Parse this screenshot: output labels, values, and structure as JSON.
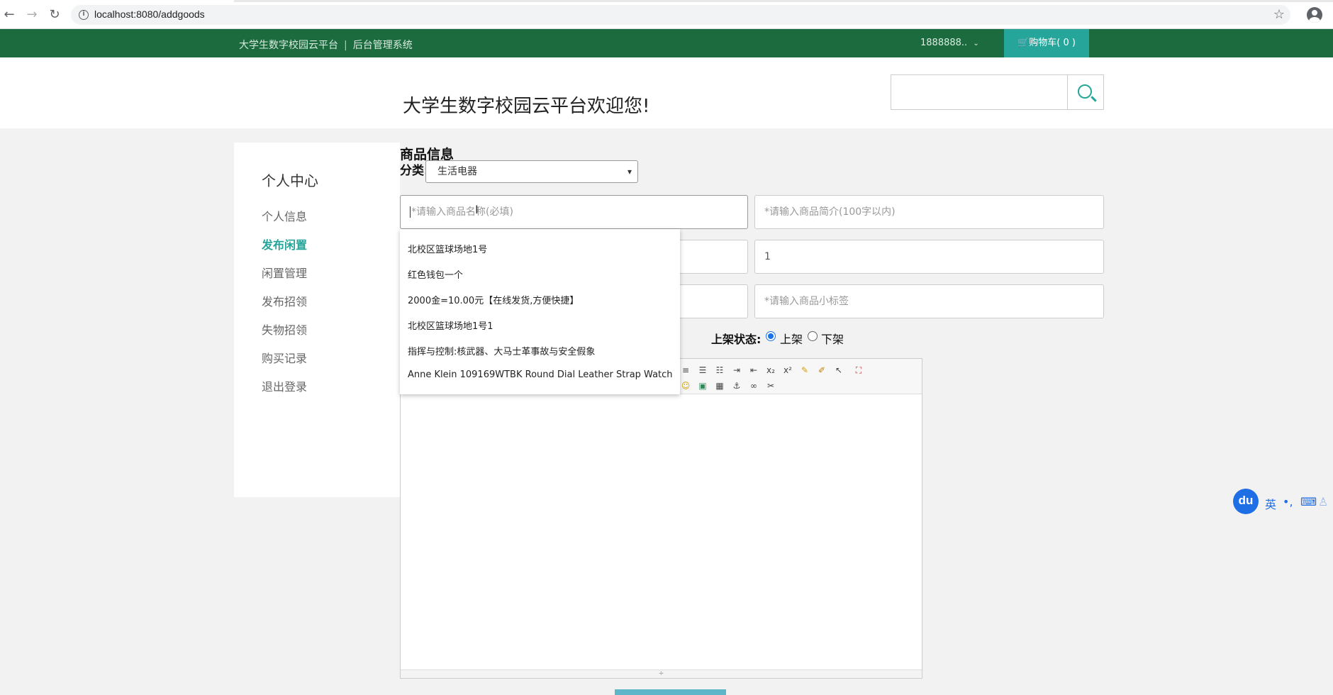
{
  "browser": {
    "url": "localhost:8080/addgoods",
    "icons": [
      "back-arrow-icon",
      "forward-arrow-icon",
      "reload-icon",
      "info-icon",
      "star-icon",
      "profile-icon"
    ]
  },
  "topbar": {
    "brand": "大学生数字校园云平台",
    "system": "后台管理系统",
    "user": "1888888..",
    "cart": "购物车( 0 )"
  },
  "header": {
    "welcome": "大学生数字校园云平台欢迎您!"
  },
  "sidebar": {
    "title": "个人中心",
    "items": [
      {
        "label": "个人信息"
      },
      {
        "label": "发布闲置"
      },
      {
        "label": "闲置管理"
      },
      {
        "label": "发布招领"
      },
      {
        "label": "失物招领"
      },
      {
        "label": "购买记录"
      },
      {
        "label": "退出登录"
      }
    ],
    "active_index": 1
  },
  "form": {
    "title": "商品信息",
    "category_label": "分类:",
    "category_value": "生活电器",
    "name_placeholder": "*请输入商品名称(必填)",
    "intro_placeholder": "*请输入商品简介(100字以内)",
    "quantity_value": "1",
    "tag_placeholder": "*请输入商品小标签",
    "status_label": "上架状态:",
    "status_on": "上架",
    "status_off": "下架",
    "status_selected": "上架"
  },
  "autocomplete": {
    "options": [
      "北校区篮球场地1号",
      "红色钱包一个",
      "2000金=10.00元【在线发货,方便快捷】",
      "北校区篮球场地1号1",
      "指挥与控制:核武器、大马士革事故与安全假象",
      "Anne Klein 109169WTBK Round Dial Leather Strap Watch"
    ]
  },
  "ime": {
    "logo": "du",
    "lang": "英"
  },
  "colors": {
    "topbar": "#1b6b3f",
    "accent": "#26a69a",
    "page_bg": "#f2f2f2"
  }
}
